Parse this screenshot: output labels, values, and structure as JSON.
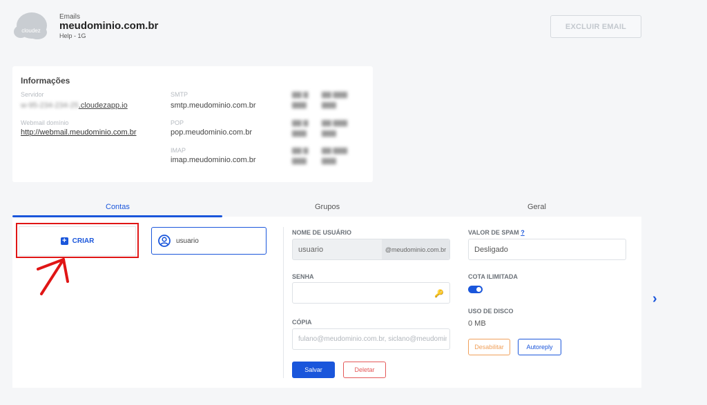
{
  "header": {
    "logo_text": "cloudez",
    "section": "Emails",
    "domain": "meudominio.com.br",
    "plan": "Help - 1G",
    "delete_label": "EXCLUIR EMAIL"
  },
  "info": {
    "title": "Informações",
    "servidor_label": "Servidor",
    "servidor_blurred": "w-95-234-234-25",
    "servidor_value": ".cloudezapp.io",
    "webmail_label": "Webmail domínio",
    "webmail_value": "http://webmail.meudominio.com.br",
    "smtp_label": "SMTP",
    "smtp_value": "smtp.meudominio.com.br",
    "pop_label": "POP",
    "pop_value": "pop.meudominio.com.br",
    "imap_label": "IMAP",
    "imap_value": "imap.meudominio.com.br"
  },
  "tabs": [
    {
      "label": "Contas"
    },
    {
      "label": "Grupos"
    },
    {
      "label": "Geral"
    }
  ],
  "accounts": {
    "create_label": "CRIAR",
    "user_label": "usuario"
  },
  "form": {
    "username_label": "NOME DE USUÁRIO",
    "username_value": "usuario",
    "username_suffix": "@meudominio.com.br",
    "password_label": "SENHA",
    "copy_label": "CÓPIA",
    "copy_placeholder": "fulano@meudominio.com.br, siclano@meudominio.com.br",
    "save_label": "Salvar",
    "delete_label": "Deletar",
    "spam_label": "VALOR DE SPAM",
    "spam_help": "?",
    "spam_value": "Desligado",
    "quota_label": "COTA ILIMITADA",
    "quota_unlimited": true,
    "disk_label": "USO DE DISCO",
    "disk_value": "0 MB",
    "disable_label": "Desabilitar",
    "autoreply_label": "Autoreply"
  },
  "colors": {
    "accent": "#1a56db",
    "danger": "#e45757",
    "warning": "#f0a05a",
    "highlight": "#e01515"
  }
}
